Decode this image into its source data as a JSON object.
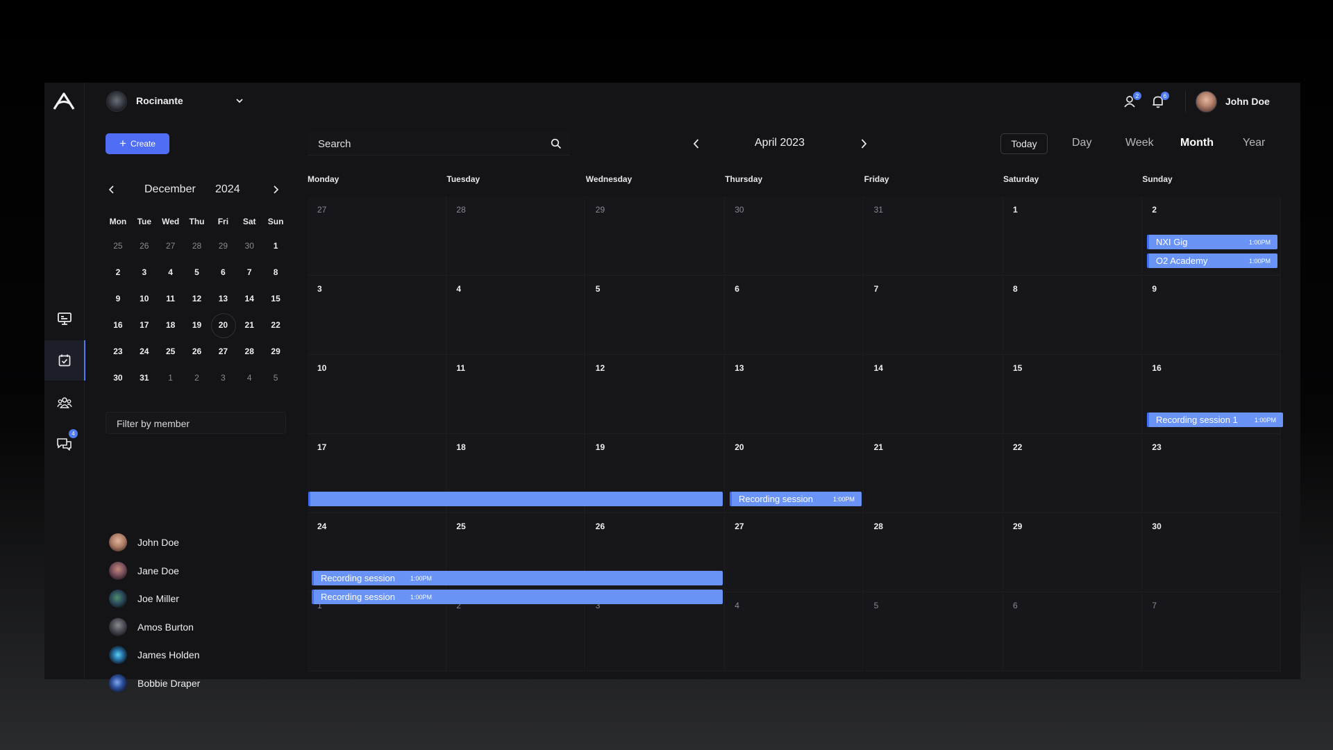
{
  "workspace": {
    "name": "Rocinante"
  },
  "user": {
    "name": "John Doe"
  },
  "header_badges": {
    "members": "2",
    "notifications": "6"
  },
  "nav": {
    "chat_badge": "4"
  },
  "create_label": "Create",
  "mini_calendar": {
    "month": "December",
    "year": "2024",
    "weekdays": [
      "Mon",
      "Tue",
      "Wed",
      "Thu",
      "Fri",
      "Sat",
      "Sun"
    ],
    "weeks": [
      [
        "25",
        "26",
        "27",
        "28",
        "29",
        "30",
        "1"
      ],
      [
        "2",
        "3",
        "4",
        "5",
        "6",
        "7",
        "8"
      ],
      [
        "9",
        "10",
        "11",
        "12",
        "13",
        "14",
        "15"
      ],
      [
        "16",
        "17",
        "18",
        "19",
        "20",
        "21",
        "22"
      ],
      [
        "23",
        "24",
        "25",
        "26",
        "27",
        "28",
        "29"
      ],
      [
        "30",
        "31",
        "1",
        "2",
        "3",
        "4",
        "5"
      ]
    ],
    "today": "20"
  },
  "filter": {
    "placeholder": "Filter by member"
  },
  "members": [
    "John Doe",
    "Jane Doe",
    "Joe Miller",
    "Amos Burton",
    "James Holden",
    "Bobbie Draper"
  ],
  "search": {
    "placeholder": "Search"
  },
  "calendar": {
    "title": "April 2023",
    "today_label": "Today",
    "views": [
      "Day",
      "Week",
      "Month",
      "Year"
    ],
    "active_view": "Month",
    "weekdays": [
      "Monday",
      "Tuesday",
      "Wednesday",
      "Thursday",
      "Friday",
      "Saturday",
      "Sunday"
    ],
    "weeks": [
      [
        "27",
        "28",
        "29",
        "30",
        "31",
        "1",
        "2"
      ],
      [
        "3",
        "4",
        "5",
        "6",
        "7",
        "8",
        "9"
      ],
      [
        "10",
        "11",
        "12",
        "13",
        "14",
        "15",
        "16"
      ],
      [
        "17",
        "18",
        "19",
        "20",
        "21",
        "22",
        "23"
      ],
      [
        "24",
        "25",
        "26",
        "27",
        "28",
        "29",
        "30"
      ],
      [
        "1",
        "2",
        "3",
        "4",
        "5",
        "6",
        "7"
      ]
    ],
    "events": [
      {
        "title": "NXI Gig",
        "time": "1:00PM"
      },
      {
        "title": "O2 Academy",
        "time": "1:00PM"
      },
      {
        "title": "Recording session 1",
        "time": "1:00PM"
      },
      {
        "title": "",
        "time": ""
      },
      {
        "title": "Recording session",
        "time": "1:00PM"
      },
      {
        "title": "Recording session",
        "time": "1:00PM"
      },
      {
        "title": "Recording session",
        "time": "1:00PM"
      }
    ]
  }
}
